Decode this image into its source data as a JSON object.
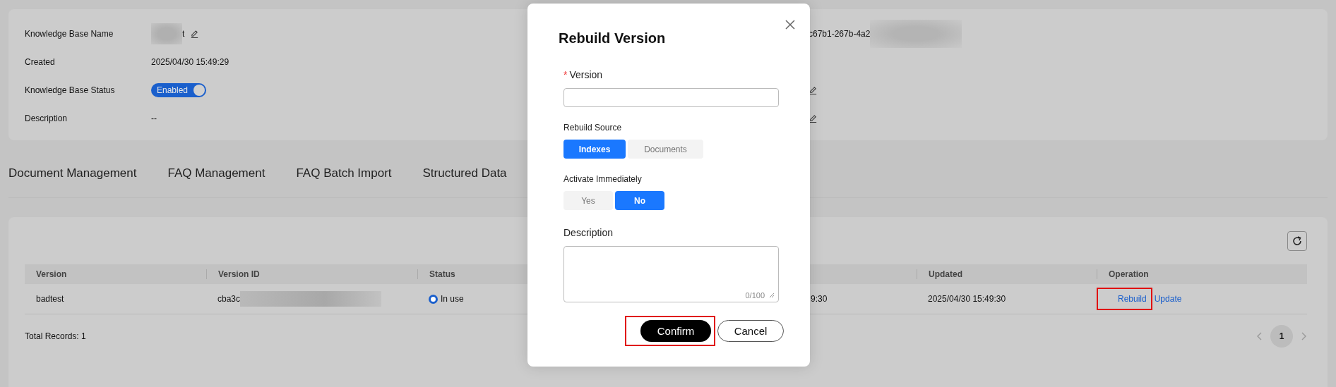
{
  "info_left": [
    {
      "label": "Knowledge Base Name",
      "kind": "editable",
      "value": "t",
      "redacted_before": true
    },
    {
      "label": "Created",
      "kind": "text",
      "value": "2025/04/30 15:49:29"
    },
    {
      "label": "Knowledge Base Status",
      "kind": "switch",
      "value": "Enabled",
      "on": true
    },
    {
      "label": "Description",
      "kind": "text",
      "value": "--"
    }
  ],
  "info_right": [
    {
      "kind": "text",
      "value": "c67b1-267b-4a2",
      "redacted_after": true
    },
    {
      "kind": "empty"
    },
    {
      "kind": "editable"
    },
    {
      "kind": "editable"
    }
  ],
  "tabs": [
    {
      "label": "Document Management",
      "selected": false
    },
    {
      "label": "FAQ Management",
      "selected": false
    },
    {
      "label": "FAQ Batch Import",
      "selected": false
    },
    {
      "label": "Structured Data",
      "selected": false
    }
  ],
  "table": {
    "columns": [
      "Version",
      "Version ID",
      "Status",
      null,
      "Updated",
      "Operation"
    ],
    "rows": [
      {
        "version": "badtest",
        "version_id": {
          "value": "cba3c",
          "redacted_after": true
        },
        "status": {
          "kind": "radio",
          "label": "In use"
        },
        "column_4": "9:30",
        "updated": "2025/04/30 15:49:30",
        "operations": [
          {
            "label": "Rebuild",
            "highlighted": true
          },
          {
            "label": "Update",
            "highlighted": false
          }
        ]
      }
    ],
    "total": "Total Records: 1",
    "pages": [
      {
        "label": "1",
        "selected": true
      }
    ]
  },
  "dialog": {
    "title": "Rebuild Version",
    "version": {
      "label": "Version",
      "required_mark": "*"
    },
    "rebuild_source": {
      "label": "Rebuild Source",
      "options": [
        {
          "label": "Indexes",
          "selected": true
        },
        {
          "label": "Documents",
          "selected": false
        }
      ]
    },
    "activate_immediately": {
      "label": "Activate Immediately",
      "options": [
        {
          "label": "Yes",
          "selected": false
        },
        {
          "label": "No",
          "selected": true
        }
      ]
    },
    "description": {
      "label": "Description",
      "counter": "0/100"
    },
    "buttons": [
      {
        "label": "Confirm",
        "kind": "primary",
        "highlighted": true
      },
      {
        "label": "Cancel",
        "kind": "secondary",
        "highlighted": false
      }
    ]
  }
}
